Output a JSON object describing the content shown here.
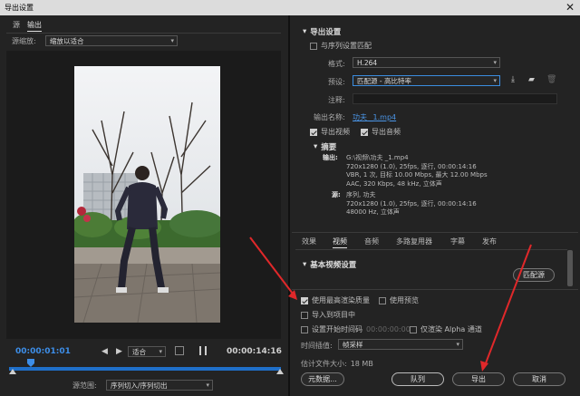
{
  "window": {
    "title": "导出设置"
  },
  "left": {
    "tabs": [
      "源",
      "输出"
    ],
    "source_scaling_label": "源缩放:",
    "source_scaling_value": "缩放以适合",
    "current_time": "00:00:01:01",
    "fit_value": "适合",
    "end_time": "00:00:14:16",
    "source_range_label": "源范围:",
    "source_range_value": "序列切入/序列切出"
  },
  "export_settings": {
    "heading": "导出设置",
    "match_sequence_label": "与序列设置匹配",
    "format_label": "格式:",
    "format_value": "H.264",
    "preset_label": "预设:",
    "preset_value": "匹配源 - 高比特率",
    "comment_label": "注释:",
    "output_name_label": "输出名称:",
    "output_name_value": "功夫 _1.mp4",
    "export_video_label": "导出视频",
    "export_audio_label": "导出音频"
  },
  "summary": {
    "heading": "摘要",
    "output_label": "输出:",
    "output_lines": [
      "G:\\视频\\功夫 _1.mp4",
      "720x1280 (1.0), 25fps, 逐行, 00:00:14:16",
      "VBR, 1 次, 目标 10.00 Mbps, 最大 12.00 Mbps",
      "AAC, 320 Kbps, 48 kHz, 立体声"
    ],
    "source_label": "源:",
    "source_lines": [
      "序列, 功夫",
      "720x1280 (1.0), 25fps, 逐行, 00:00:14:16",
      "48000 Hz, 立体声"
    ]
  },
  "settings_tabs": [
    "效果",
    "视频",
    "音频",
    "多路复用器",
    "字幕",
    "发布"
  ],
  "basic_video": {
    "heading": "基本视频设置",
    "match_source_button": "匹配源"
  },
  "options": {
    "max_render_quality": "使用最高渲染质量",
    "use_previews": "使用预览",
    "import_into_project": "导入到项目中",
    "set_start_timecode": "设置开始时间码",
    "start_timecode_value": "00:00:00:00",
    "render_alpha_only": "仅渲染 Alpha 通道",
    "time_interpolation_label": "时间插值:",
    "time_interpolation_value": "帧采样",
    "estimated_size_label": "估计文件大小:",
    "estimated_size_value": "18 MB"
  },
  "buttons": {
    "metadata": "元数据...",
    "queue": "队列",
    "export": "导出",
    "cancel": "取消"
  },
  "colors": {
    "accent_blue": "#3d8ee8",
    "annotation_red": "#e0282a"
  }
}
